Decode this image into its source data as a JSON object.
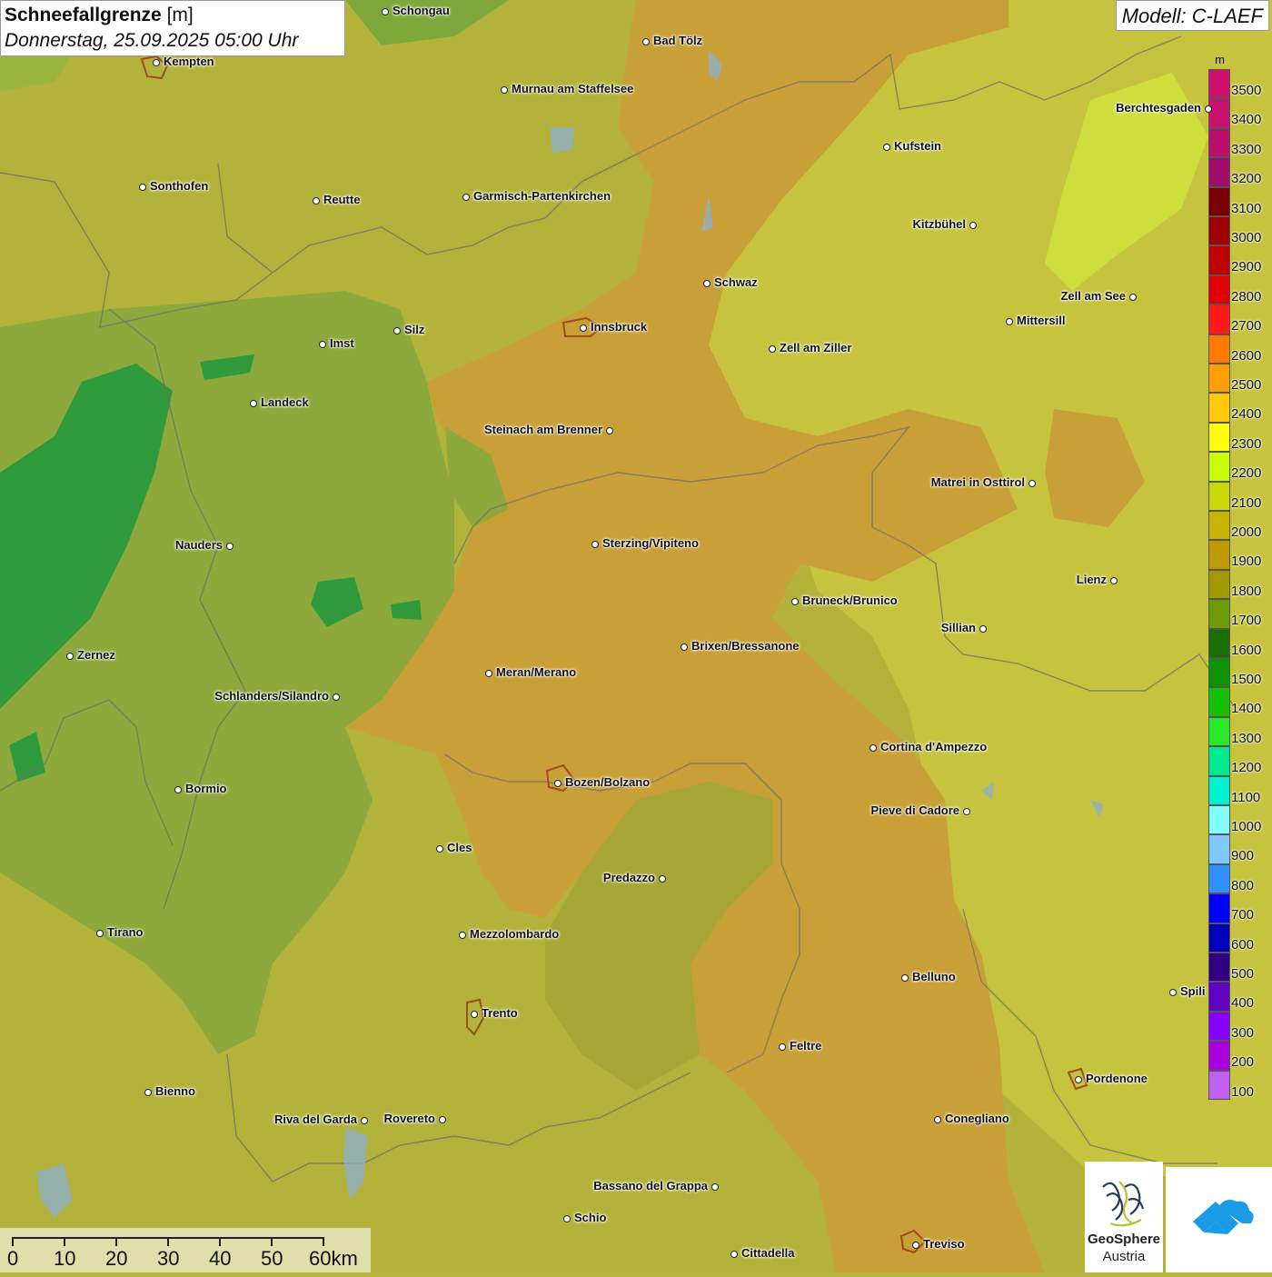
{
  "header": {
    "title_bold": "Schneefallgrenze",
    "title_unit": "[m]",
    "datetime": "Donnerstag, 25.09.2025 05:00 Uhr",
    "model": "Modell: C-LAEF"
  },
  "legend": {
    "unit": "m",
    "items": [
      {
        "value": "3500",
        "color": "#d0106a"
      },
      {
        "value": "3400",
        "color": "#c8106e"
      },
      {
        "value": "3300",
        "color": "#b80e6c"
      },
      {
        "value": "3200",
        "color": "#a00c6a"
      },
      {
        "value": "3100",
        "color": "#7a0000"
      },
      {
        "value": "3000",
        "color": "#a00000"
      },
      {
        "value": "2900",
        "color": "#c00000"
      },
      {
        "value": "2800",
        "color": "#e00000"
      },
      {
        "value": "2700",
        "color": "#ff1a1a"
      },
      {
        "value": "2600",
        "color": "#ff7a00"
      },
      {
        "value": "2500",
        "color": "#ff9e00"
      },
      {
        "value": "2400",
        "color": "#ffc800"
      },
      {
        "value": "2300",
        "color": "#ffff00"
      },
      {
        "value": "2200",
        "color": "#c8ff00"
      },
      {
        "value": "2100",
        "color": "#c8d800"
      },
      {
        "value": "2000",
        "color": "#c8b400"
      },
      {
        "value": "1900",
        "color": "#c09a00"
      },
      {
        "value": "1800",
        "color": "#a09a00"
      },
      {
        "value": "1700",
        "color": "#6c9a00"
      },
      {
        "value": "1600",
        "color": "#1a6e00"
      },
      {
        "value": "1500",
        "color": "#0c9400"
      },
      {
        "value": "1400",
        "color": "#14c000"
      },
      {
        "value": "1300",
        "color": "#28e828"
      },
      {
        "value": "1200",
        "color": "#00e890"
      },
      {
        "value": "1100",
        "color": "#00f0d0"
      },
      {
        "value": "1000",
        "color": "#80ffff"
      },
      {
        "value": "900",
        "color": "#80c8ff"
      },
      {
        "value": "800",
        "color": "#3090ff"
      },
      {
        "value": "700",
        "color": "#0000ff"
      },
      {
        "value": "600",
        "color": "#0000b8"
      },
      {
        "value": "500",
        "color": "#300080"
      },
      {
        "value": "400",
        "color": "#6000c0"
      },
      {
        "value": "300",
        "color": "#8800ff"
      },
      {
        "value": "200",
        "color": "#aa00e0"
      },
      {
        "value": "100",
        "color": "#c060f0"
      }
    ]
  },
  "cities": [
    {
      "name": "Schongau"
    },
    {
      "name": "Bad Tölz"
    },
    {
      "name": "Kempten"
    },
    {
      "name": "Murnau am Staffelsee"
    },
    {
      "name": "Berchtesgaden"
    },
    {
      "name": "Kufstein"
    },
    {
      "name": "Sonthofen"
    },
    {
      "name": "Reutte"
    },
    {
      "name": "Garmisch-Partenkirchen"
    },
    {
      "name": "Kitzbühel"
    },
    {
      "name": "Schwaz"
    },
    {
      "name": "Zell am See"
    },
    {
      "name": "Mittersill"
    },
    {
      "name": "Innsbruck"
    },
    {
      "name": "Silz"
    },
    {
      "name": "Imst"
    },
    {
      "name": "Zell am Ziller"
    },
    {
      "name": "Landeck"
    },
    {
      "name": "Steinach am Brenner"
    },
    {
      "name": "Matrei in Osttirol"
    },
    {
      "name": "Nauders"
    },
    {
      "name": "Sterzing/Vipiteno"
    },
    {
      "name": "Lienz"
    },
    {
      "name": "Bruneck/Brunico"
    },
    {
      "name": "Sillian"
    },
    {
      "name": "Brixen/Bressanone"
    },
    {
      "name": "Zernez"
    },
    {
      "name": "Meran/Merano"
    },
    {
      "name": "Schlanders/Silandro"
    },
    {
      "name": "Cortina d'Ampezzo"
    },
    {
      "name": "Bozen/Bolzano"
    },
    {
      "name": "Bormio"
    },
    {
      "name": "Pieve di Cadore"
    },
    {
      "name": "Cles"
    },
    {
      "name": "Predazzo"
    },
    {
      "name": "Tirano"
    },
    {
      "name": "Mezzolombardo"
    },
    {
      "name": "Belluno"
    },
    {
      "name": "Spili"
    },
    {
      "name": "Trento"
    },
    {
      "name": "Feltre"
    },
    {
      "name": "Pordenone"
    },
    {
      "name": "Bienno"
    },
    {
      "name": "Riva del Garda"
    },
    {
      "name": "Rovereto"
    },
    {
      "name": "Conegliano"
    },
    {
      "name": "Bassano del Grappa"
    },
    {
      "name": "Schio"
    },
    {
      "name": "Treviso"
    },
    {
      "name": "Cittadella"
    }
  ],
  "scale": {
    "labels": [
      "0",
      "10",
      "20",
      "30",
      "40",
      "50",
      "60km"
    ]
  },
  "logo": {
    "line1": "GeoSphere",
    "line2": "Austria"
  }
}
